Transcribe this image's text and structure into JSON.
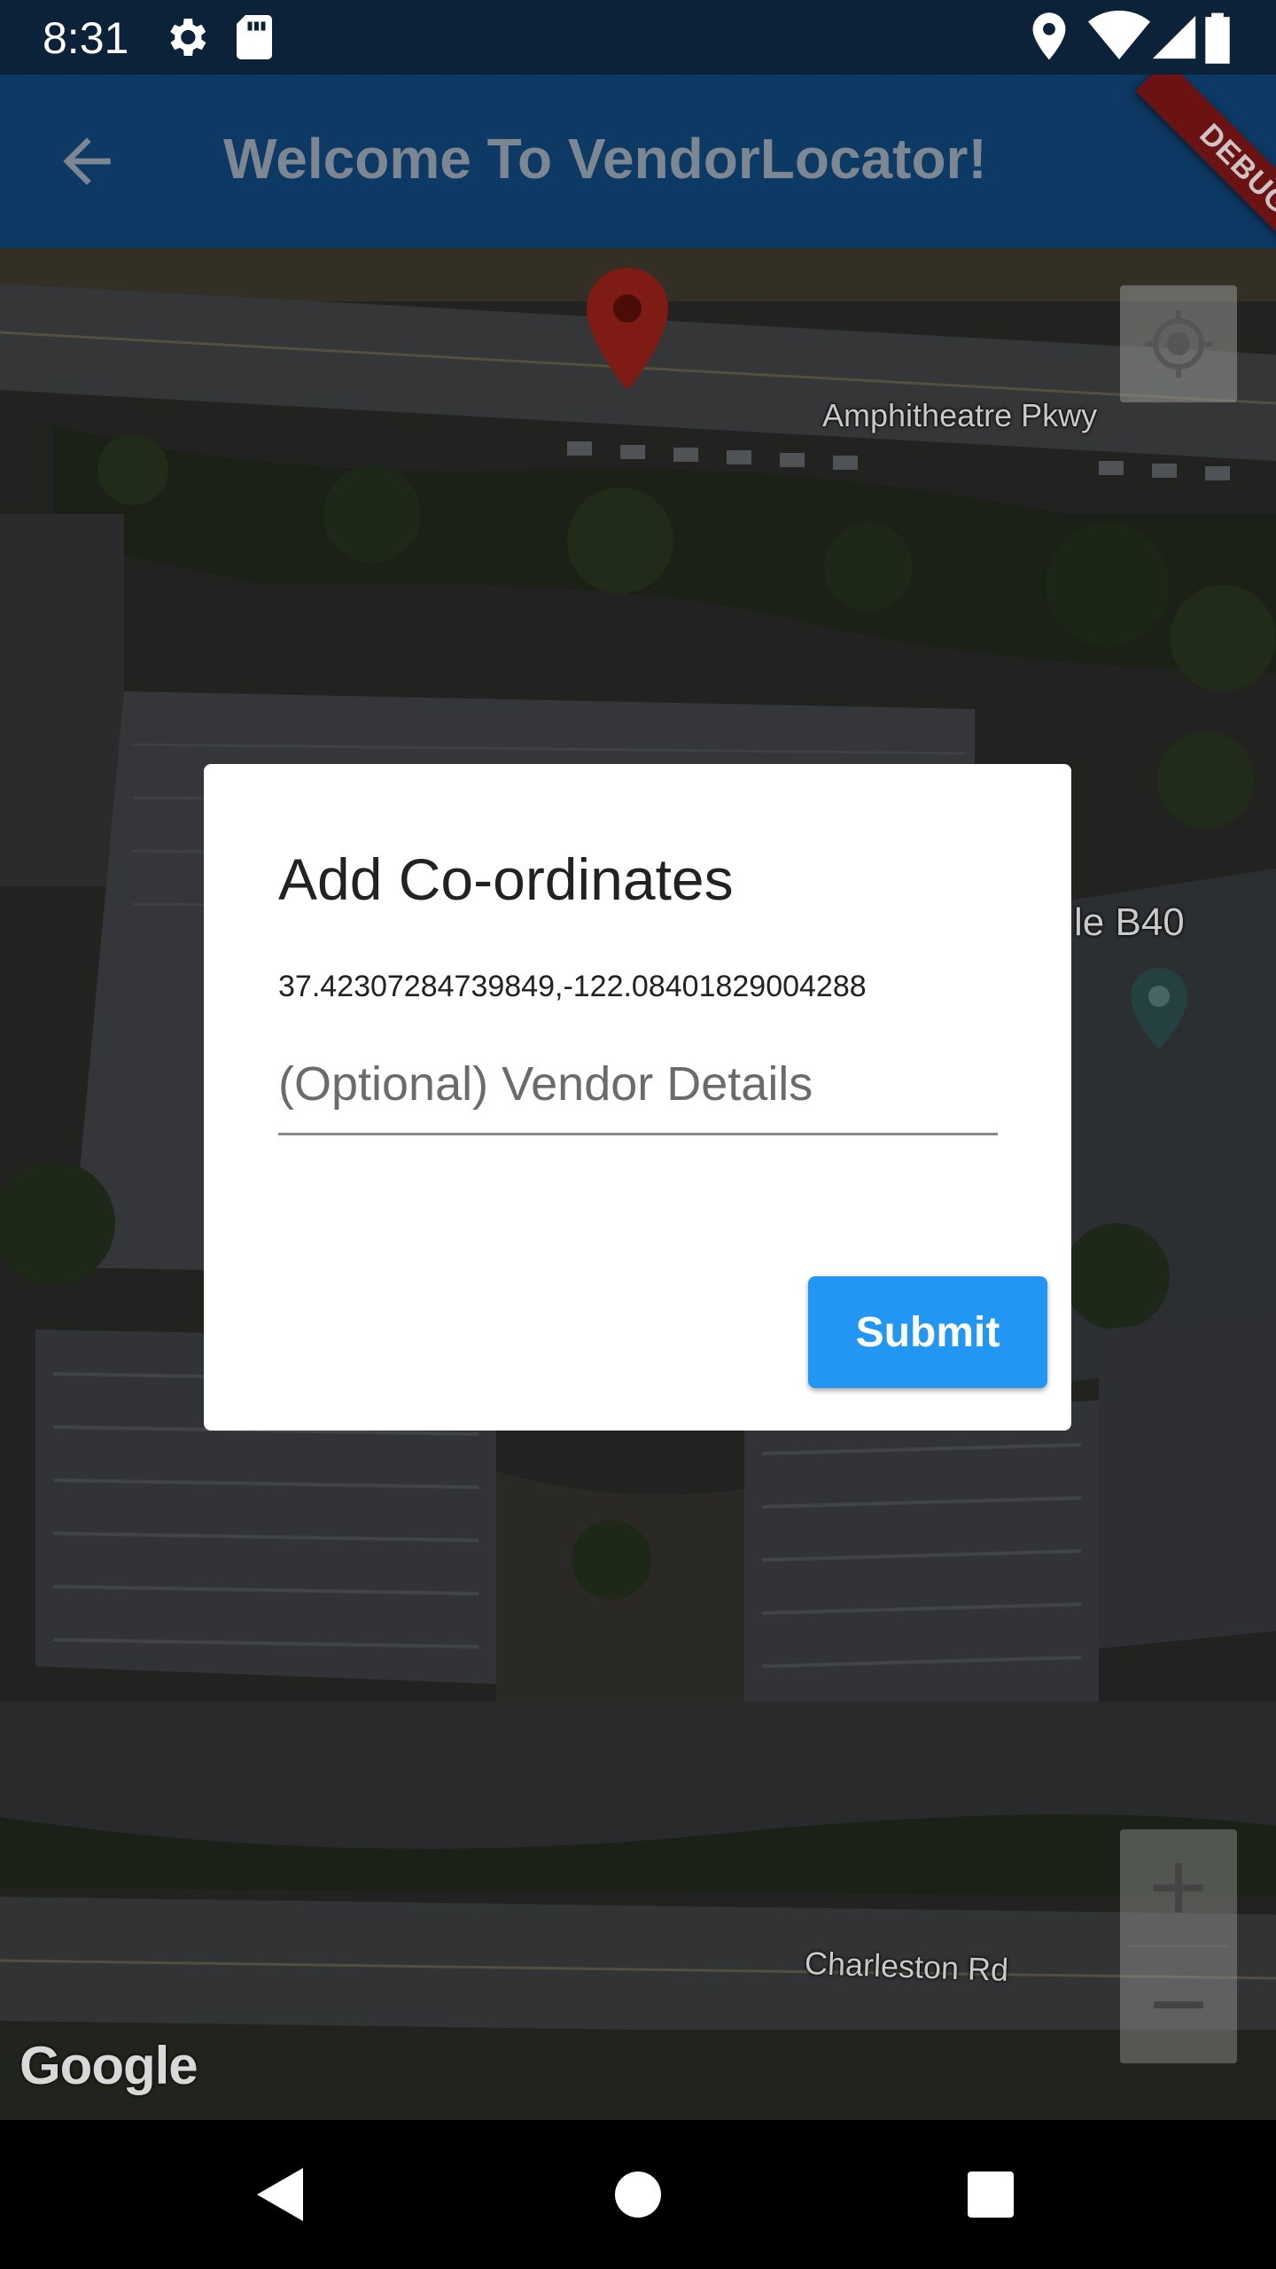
{
  "status_bar": {
    "time": "8:31",
    "icons": [
      "gear-icon",
      "sd-card-icon",
      "location-icon",
      "wifi-icon",
      "signal-icon",
      "battery-icon"
    ]
  },
  "app_bar": {
    "title": "Welcome To VendorLocator!",
    "back_icon": "arrow-back-icon",
    "debug_banner": "DEBUG",
    "color": "#0d3a64"
  },
  "map": {
    "labels": {
      "street_top": "Amphitheatre Pkwy",
      "building": "le B40",
      "street_bottom": "Charleston Rd"
    },
    "attribution": "Google",
    "controls": {
      "my_location_icon": "my-location-icon",
      "zoom_in": "+",
      "zoom_out": "−"
    },
    "marker_color": "#b52a20"
  },
  "dialog": {
    "title": "Add Co-ordinates",
    "coordinates": "37.42307284739849,-122.08401829004288",
    "input": {
      "placeholder": "(Optional) Vendor Details",
      "value": ""
    },
    "submit_label": "Submit",
    "accent": "#2196f3"
  },
  "nav_bar": {
    "icons": [
      "back-triangle-icon",
      "home-circle-icon",
      "recents-square-icon"
    ]
  }
}
